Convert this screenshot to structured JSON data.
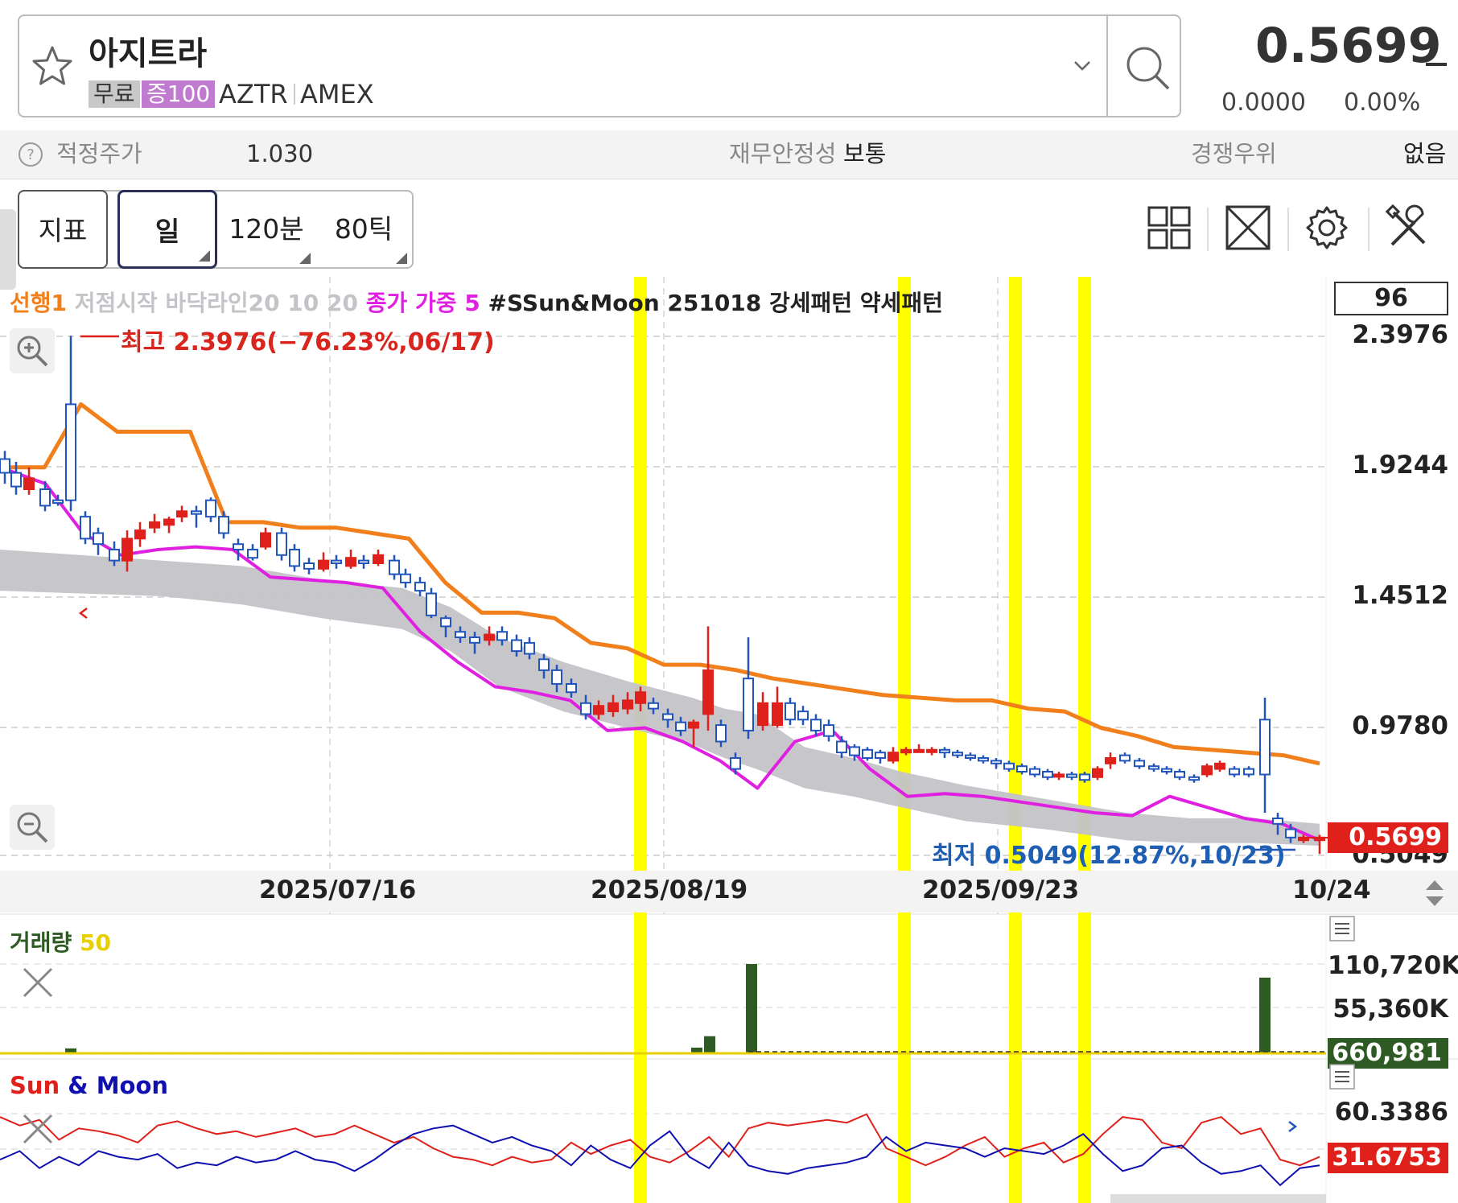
{
  "stock": {
    "name": "아지트라",
    "tag_free": "무료",
    "tag_margin": "증100",
    "ticker": "AZTR",
    "exchange": "AMEX",
    "price": "0.5699",
    "change": "0.0000",
    "change_pct": "0.00%"
  },
  "info": {
    "fair_label": "적정주가",
    "fair_value": "1.030",
    "fin_label": "재무안정성",
    "fin_value": "보통",
    "comp_label": "경쟁우위",
    "comp_value": "없음"
  },
  "toolbar": {
    "indicator": "지표",
    "day": "일",
    "min120": "120분",
    "tick80": "80틱"
  },
  "main_chart": {
    "legend_lead": "선행1",
    "legend_support": "저점시작 바닥라인20 10 20",
    "legend_close": "종가 가중 5",
    "legend_script": "#SSun&Moon 251018 강세패턴 약세패턴",
    "count_box": "96",
    "high_annotation": "최고 2.3976(−76.23%,06/17)",
    "low_annotation": "최저 0.5049(12.87%,10/23)",
    "y_ticks": [
      "2.3976",
      "1.9244",
      "1.4512",
      "0.9780",
      "0.5049"
    ],
    "current_price": "0.5699",
    "x_ticks": [
      "2025/07/16",
      "2025/08/19",
      "2025/09/23",
      "10/24"
    ]
  },
  "volume_panel": {
    "title": "거래량",
    "period": "50",
    "y_ticks": [
      "110,720K",
      "55,360K"
    ],
    "current": "660,981"
  },
  "sun_moon_panel": {
    "title_sun": "Sun",
    "title_amp": "&",
    "title_moon": "Moon",
    "y_tick": "60.3386",
    "current": "31.6753"
  },
  "colors": {
    "up": "#e0201a",
    "down": "#2255bb",
    "lead_line": "#f07f1c",
    "ma_line": "#e020e0",
    "band": "#c4c3c8",
    "highlight": "#ffff00",
    "volume": "#2e5a23",
    "sun": "#e0201a",
    "moon": "#1010b0"
  },
  "icons": {
    "star": "star-icon",
    "search": "search-icon",
    "help": "help-icon",
    "layout": "grid-layout-icon",
    "fullscreen": "fullscreen-icon",
    "settings": "gear-icon",
    "tools": "tools-icon"
  },
  "chart_data": {
    "type": "candlestick",
    "x_range": [
      "2025/06/17",
      "2025/10/24"
    ],
    "y_range": [
      0.5049,
      2.3976
    ],
    "high": {
      "value": 2.3976,
      "date": "06/17",
      "pct": -76.23
    },
    "low": {
      "value": 0.5049,
      "date": "10/23",
      "pct": 12.87
    },
    "last": 0.5699,
    "series": [
      {
        "name": "선행1",
        "values_approx": [
          1.92,
          1.92,
          2.15,
          2.05,
          2.05,
          2.05,
          1.72,
          1.72,
          1.7,
          1.7,
          1.68,
          1.66,
          1.5,
          1.39,
          1.39,
          1.37,
          1.28,
          1.26,
          1.2,
          1.2,
          1.18,
          1.15,
          1.13,
          1.11,
          1.09,
          1.08,
          1.07,
          1.07,
          1.04,
          1.03,
          0.97,
          0.94,
          0.9,
          0.89,
          0.88,
          0.87,
          0.84
        ]
      },
      {
        "name": "종가 가중 5",
        "values_approx": [
          1.91,
          1.86,
          1.68,
          1.6,
          1.62,
          1.63,
          1.62,
          1.52,
          1.51,
          1.5,
          1.48,
          1.32,
          1.21,
          1.12,
          1.1,
          1.07,
          0.96,
          0.97,
          0.92,
          0.85,
          0.75,
          0.92,
          0.96,
          0.82,
          0.72,
          0.73,
          0.72,
          0.7,
          0.68,
          0.66,
          0.65,
          0.72,
          0.68,
          0.64,
          0.62,
          0.56
        ]
      }
    ],
    "highlighted_dates": [
      "~2025/08/14",
      "~2025/09/17",
      "~2025/09/30",
      "~2025/10/08"
    ]
  }
}
